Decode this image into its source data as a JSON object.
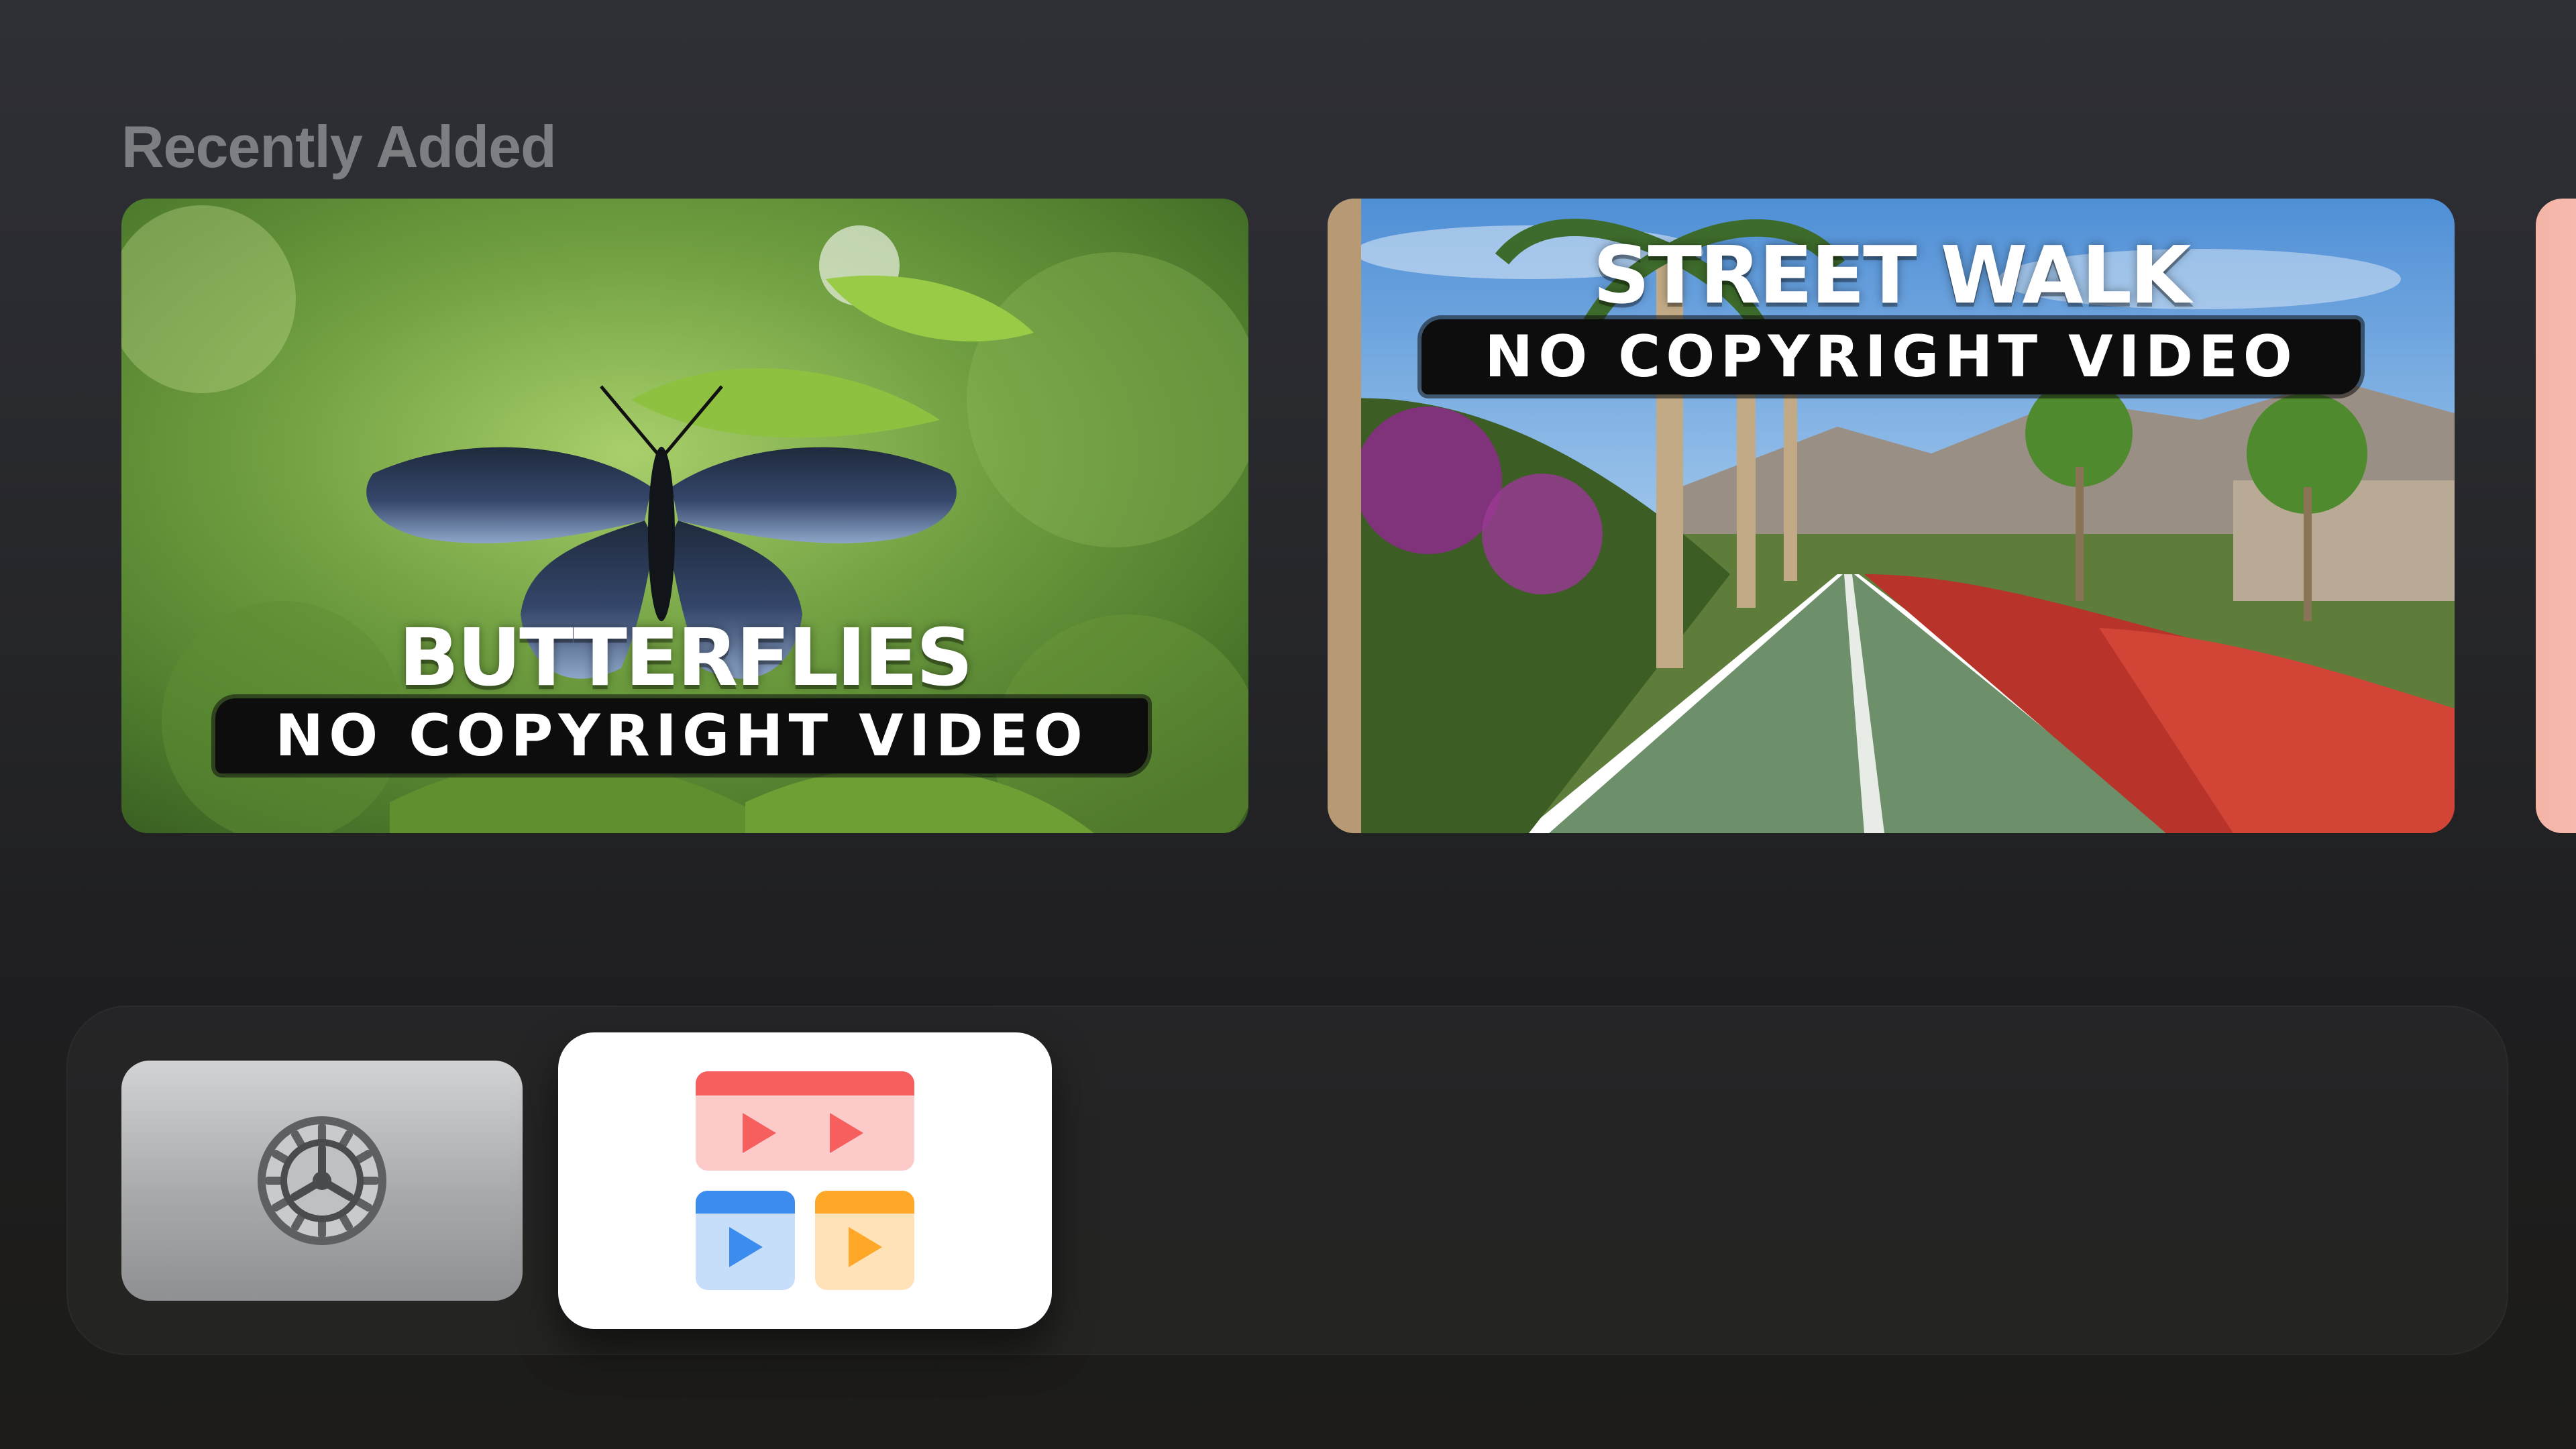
{
  "section": {
    "title": "Recently Added"
  },
  "tiles": [
    {
      "title": "BUTTERFLIES",
      "subtitle": "NO COPYRIGHT VIDEO",
      "image": "butterfly-on-leaf"
    },
    {
      "title": "STREET WALK",
      "subtitle": "NO COPYRIGHT VIDEO",
      "image": "street-bike-path"
    }
  ],
  "dock": {
    "apps": [
      {
        "name": "Settings",
        "icon": "gear-icon"
      },
      {
        "name": "Infuse",
        "icon": "video-library-icon",
        "focused": true
      }
    ]
  },
  "colors": {
    "background": "#26272b",
    "section_title": "#7d7e82",
    "focused_app_bg": "#ffffff",
    "infuse_red": "#f75e5e",
    "infuse_blue": "#3c8cf0",
    "infuse_orange": "#ffa726"
  }
}
